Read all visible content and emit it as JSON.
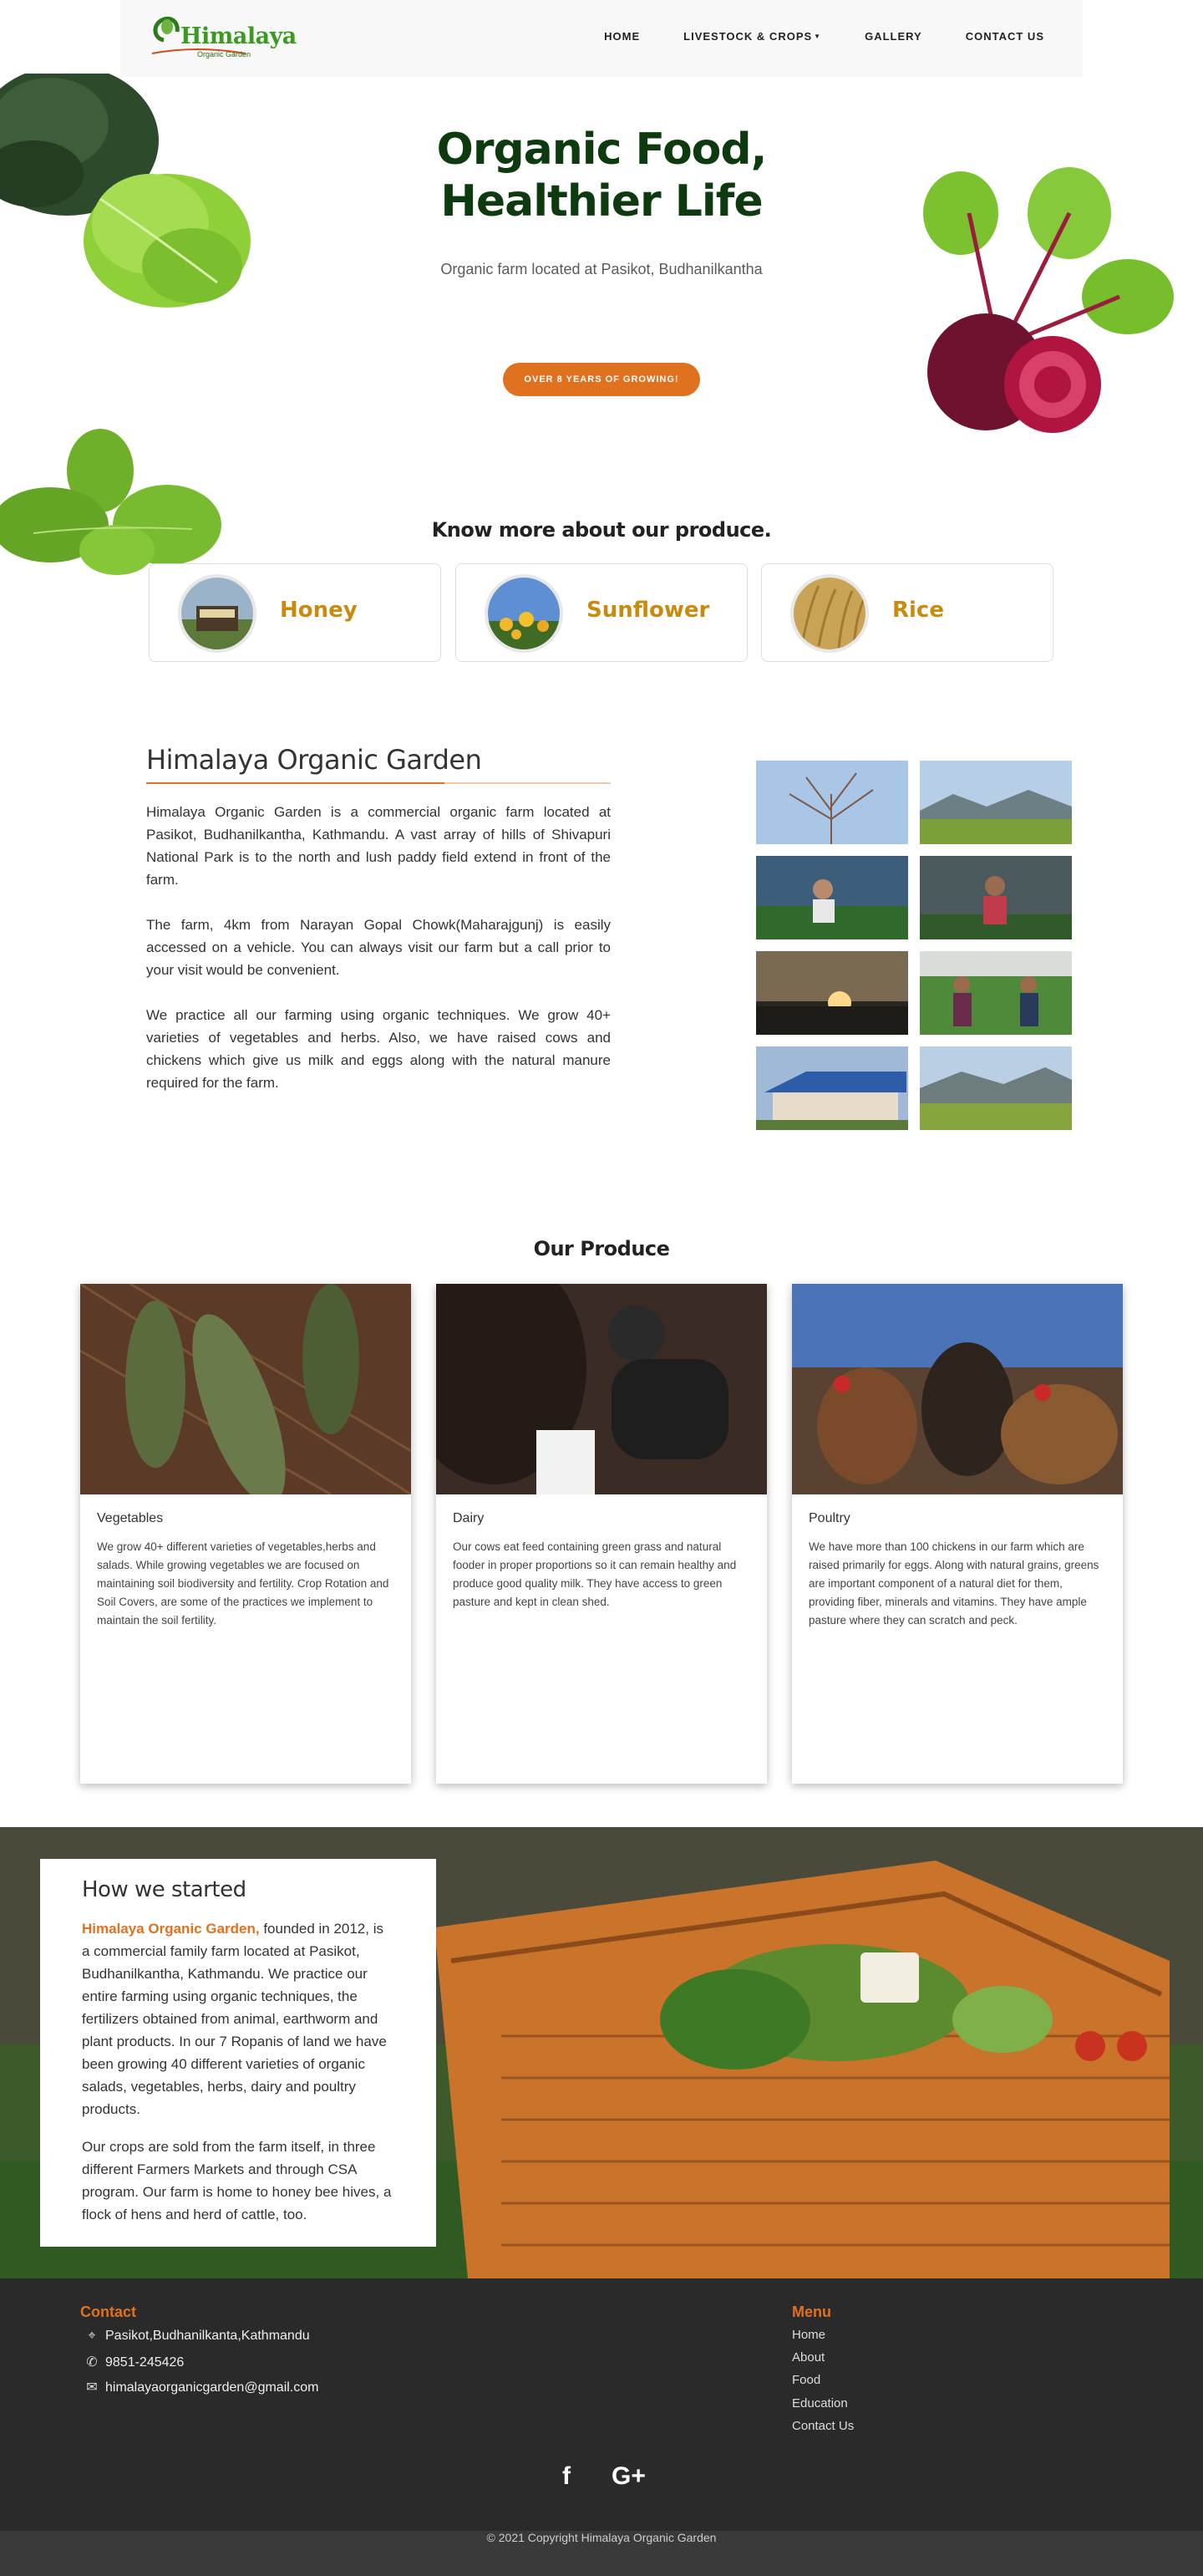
{
  "brand": {
    "name": "Himalaya",
    "tagline": "Organic Garden"
  },
  "nav": {
    "items": [
      {
        "label": "HOME"
      },
      {
        "label": "LIVESTOCK & CROPS"
      },
      {
        "label": "GALLERY"
      },
      {
        "label": "CONTACT US"
      }
    ]
  },
  "hero": {
    "title_line1": "Organic Food,",
    "title_line2": "Healthier Life",
    "subtitle": "Organic farm located at Pasikot, Budhanilkantha",
    "button": "OVER 8 YEARS OF GROWING!"
  },
  "produce_links": {
    "heading": "Know more about our produce.",
    "items": [
      {
        "label": "Honey"
      },
      {
        "label": "Sunflower"
      },
      {
        "label": "Rice"
      }
    ]
  },
  "about": {
    "title": "Himalaya Organic Garden",
    "paragraphs": [
      "Himalaya Organic Garden is a commercial organic farm located at Pasikot, Budhanilkantha, Kathmandu. A vast array of hills of Shivapuri National Park is to the north and lush paddy field extend in front of the farm.",
      "The farm, 4km from Narayan Gopal Chowk(Maharajgunj) is easily accessed on a vehicle. You can always visit our farm but a call prior to your visit would be convenient.",
      "We practice all our farming using organic techniques. We grow 40+ varieties of vegetables and herbs. Also, we have raised cows and chickens which give us milk and eggs along with the natural manure required for the farm."
    ]
  },
  "our_produce": {
    "heading": "Our Produce",
    "cards": [
      {
        "title": "Vegetables",
        "text": "We grow 40+ different varieties of vegetables,herbs and salads. While growing vegetables we are focused on maintaining soil biodiversity and fertility. Crop Rotation and Soil Covers, are some of the practices we implement to maintain the soil fertility."
      },
      {
        "title": "Dairy",
        "text": "Our cows eat feed containing green grass and natural fooder in proper proportions so it can remain healthy and produce good quality milk. They have access to green pasture and kept in clean shed."
      },
      {
        "title": "Poultry",
        "text": "We have more than 100 chickens in our farm which are raised primarily for eggs. Along with natural grains, greens are important component of a natural diet for them, providing fiber, minerals and vitamins. They have ample pasture where they can scratch and peck."
      }
    ]
  },
  "started": {
    "title": "How we started",
    "highlight": "Himalaya Organic Garden,",
    "p1_rest": " founded in 2012, is a commercial family farm located at Pasikot, Budhanilkantha, Kathmandu. We practice our entire farming using organic techniques, the fertilizers obtained from animal, earthworm and plant products. In our 7 Ropanis of land we have been growing 40 different varieties of organic salads, vegetables, herbs, dairy and poultry products.",
    "p2": "Our crops are sold from the farm itself, in three different Farmers Markets and through CSA program. Our farm is home to honey bee hives, a flock of hens and herd of cattle, too."
  },
  "footer": {
    "contact_heading": "Contact",
    "address": "Pasikot,Budhanilkanta,Kathmandu",
    "phone": "9851-245426",
    "email": "himalayaorganicgarden@gmail.com",
    "menu_heading": "Menu",
    "menu": [
      {
        "label": "Home"
      },
      {
        "label": "About"
      },
      {
        "label": "Food"
      },
      {
        "label": "Education"
      },
      {
        "label": "Contact Us"
      }
    ],
    "social": {
      "facebook": "f",
      "google_plus": "G+"
    },
    "copyright": "© 2021 Copyright Himalaya Organic Garden"
  },
  "colors": {
    "accent": "#e0711e",
    "brand_green": "#3c9a23",
    "hero_title": "#0d3a0f",
    "footer_bg": "#2a2a2a",
    "produce_label": "#c98b0f"
  },
  "icons": [
    "map-marker-icon",
    "phone-icon",
    "envelope-icon",
    "facebook-icon",
    "google-plus-icon"
  ]
}
